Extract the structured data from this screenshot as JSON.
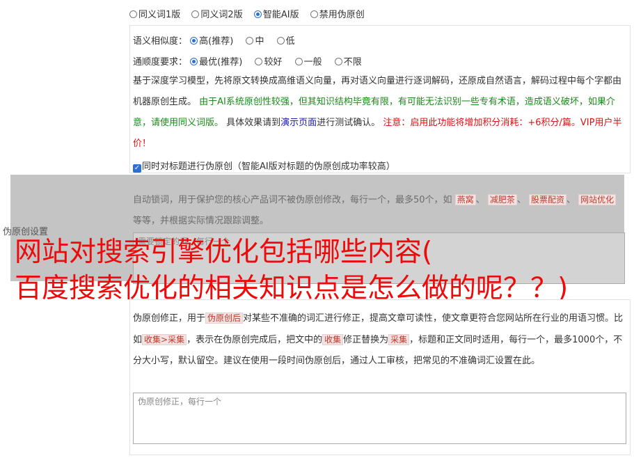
{
  "modes": [
    {
      "label": "同义词1版",
      "selected": false
    },
    {
      "label": "同义词2版",
      "selected": false
    },
    {
      "label": "智能AI版",
      "selected": true
    },
    {
      "label": "禁用伪原创",
      "selected": false
    }
  ],
  "similarity": {
    "label": "语义相似度：",
    "options": [
      {
        "label": "高(推荐)",
        "selected": true
      },
      {
        "label": "中",
        "selected": false
      },
      {
        "label": "低",
        "selected": false
      }
    ]
  },
  "fluency": {
    "label": "通顺度要求：",
    "options": [
      {
        "label": "最优(推荐)",
        "selected": true
      },
      {
        "label": "较好",
        "selected": false
      },
      {
        "label": "一般",
        "selected": false
      },
      {
        "label": "不限",
        "selected": false
      }
    ]
  },
  "description": {
    "part1": "基于深度学习模型，先将原文转换成高维语义向量，再对语义向量进行逐词解码，还原成自然语言，解码过程中每个字都由机器原创生成。",
    "part2_green": "由于AI系统原创性较强，但其知识结构毕竟有限，有可能无法识别一些专有术语，造成语义破坏，如果介意，请使用同义词版。",
    "part3": "具体效果请到",
    "link": "演示页面",
    "part4": "进行测试确认。",
    "part5_red": "注意：启用此功能将增加积分消耗：+6积分/篇。VIP用户半价！"
  },
  "title_checkbox": {
    "label": "同时对标题进行伪原创（智能AI版对标题的伪原创成功率较高）",
    "checked": true
  },
  "left_label": "伪原创设置",
  "lock_words": {
    "text1": "自动锁词，用于保护您的核心产品词不被伪原创修改，每行一个，最多50个，如",
    "examples": [
      "燕窝",
      "减肥茶",
      "股票配资",
      "网站优化"
    ],
    "text2": "等等，并根据实际情况跟踪调整。",
    "placeholder": "需要锁定的词，每行一个"
  },
  "overlay": {
    "line1": "网站对搜索引擎优化包括哪些内容(",
    "line2": "百度搜索优化的相关知识点是怎么做的呢？？)"
  },
  "fix": {
    "t1": "伪原创修正，用于",
    "tag1": "伪原创后",
    "t2": "对某些不准确的词汇进行修正，提高文章可读性，使文章更符合您网站所在行业的用语习惯。比如",
    "tag2": "收集>采集",
    "t3": "，表示在伪原创完成后，把文中的",
    "tag3": "收集",
    "t4": "修正替换为",
    "tag4": "采集",
    "t5": "，标题和正文同时适用，每行一个，最多1000个，不分大小写，默认留空。建议在使用一段时间伪原创后，通过人工审核，把常见的不准确词汇设置在此。",
    "placeholder": "伪原创修正，每行一个"
  },
  "colors": {
    "accent": "#2a6fd6",
    "overlay_red": "#ee0a0a",
    "green": "#1a8a1a",
    "warn_red": "#dd1111",
    "link_blue": "#1a1aa8"
  }
}
